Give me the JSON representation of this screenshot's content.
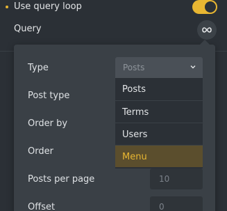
{
  "loop": {
    "label": "Use query loop",
    "enabled": true,
    "accent": "#e8b632"
  },
  "query": {
    "label": "Query",
    "icon": "infinity-icon"
  },
  "popup": {
    "type_label": "Type",
    "type_select": {
      "value": "Posts",
      "icon": "chevron-down-icon"
    },
    "type_options": [
      "Posts",
      "Terms",
      "Users",
      "Menu"
    ],
    "highlighted_option": "Menu",
    "post_type_label": "Post type",
    "order_by_label": "Order by",
    "order_label": "Order",
    "posts_per_page_label": "Posts per page",
    "posts_per_page_placeholder": "10",
    "offset_label": "Offset",
    "offset_placeholder": "0"
  }
}
